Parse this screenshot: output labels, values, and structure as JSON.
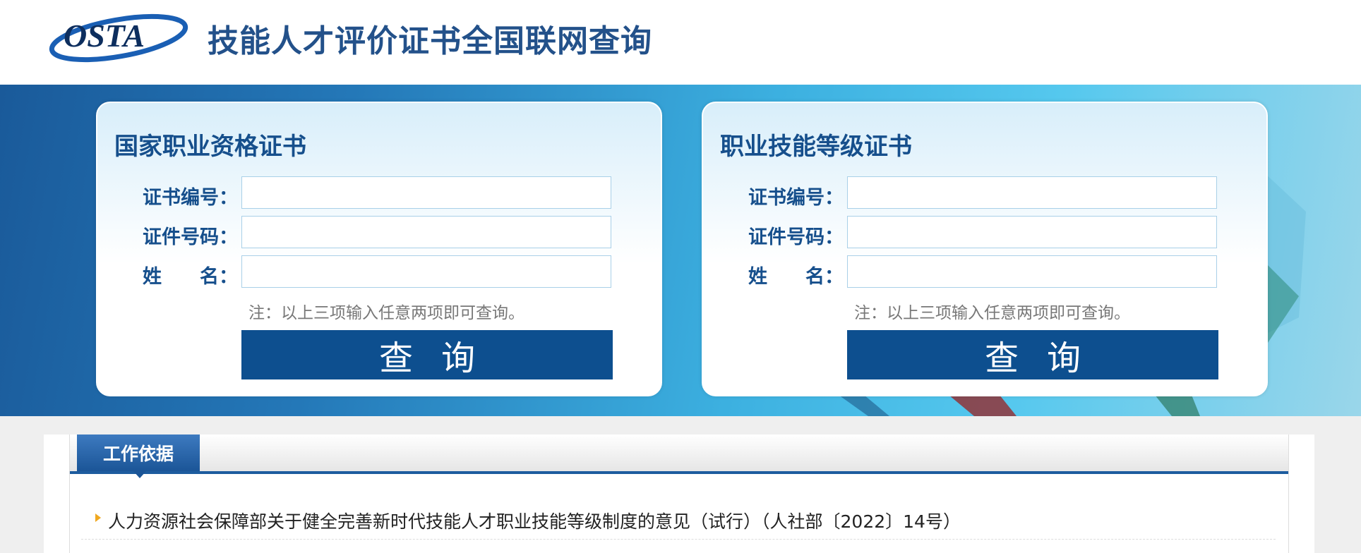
{
  "header": {
    "logo_text": "OSTA",
    "site_title": "技能人才评价证书全国联网查询"
  },
  "panels": [
    {
      "title": "国家职业资格证书",
      "fields": [
        {
          "label": "证书编号：",
          "value": "",
          "placeholder": ""
        },
        {
          "label": "证件号码：",
          "value": "",
          "placeholder": ""
        },
        {
          "label": "姓　　名：",
          "value": "",
          "placeholder": ""
        }
      ],
      "note": "注：以上三项输入任意两项即可查询。",
      "button_label": "查询"
    },
    {
      "title": "职业技能等级证书",
      "fields": [
        {
          "label": "证书编号：",
          "value": "",
          "placeholder": ""
        },
        {
          "label": "证件号码：",
          "value": "",
          "placeholder": ""
        },
        {
          "label": "姓　　名：",
          "value": "",
          "placeholder": ""
        }
      ],
      "note": "注：以上三项输入任意两项即可查询。",
      "button_label": "查询"
    }
  ],
  "section": {
    "tab_label": "工作依据",
    "items": [
      "人力资源社会保障部关于健全完善新时代技能人才职业技能等级制度的意见（试行）（人社部〔2022〕14号）"
    ]
  },
  "colors": {
    "brand_blue": "#164f8c",
    "button_blue": "#0d4f8f",
    "title_blue": "#23518a",
    "bullet_orange": "#f0a820"
  },
  "icons": {
    "logo": "osta-logo",
    "bullet": "triangle-bullet-icon"
  }
}
